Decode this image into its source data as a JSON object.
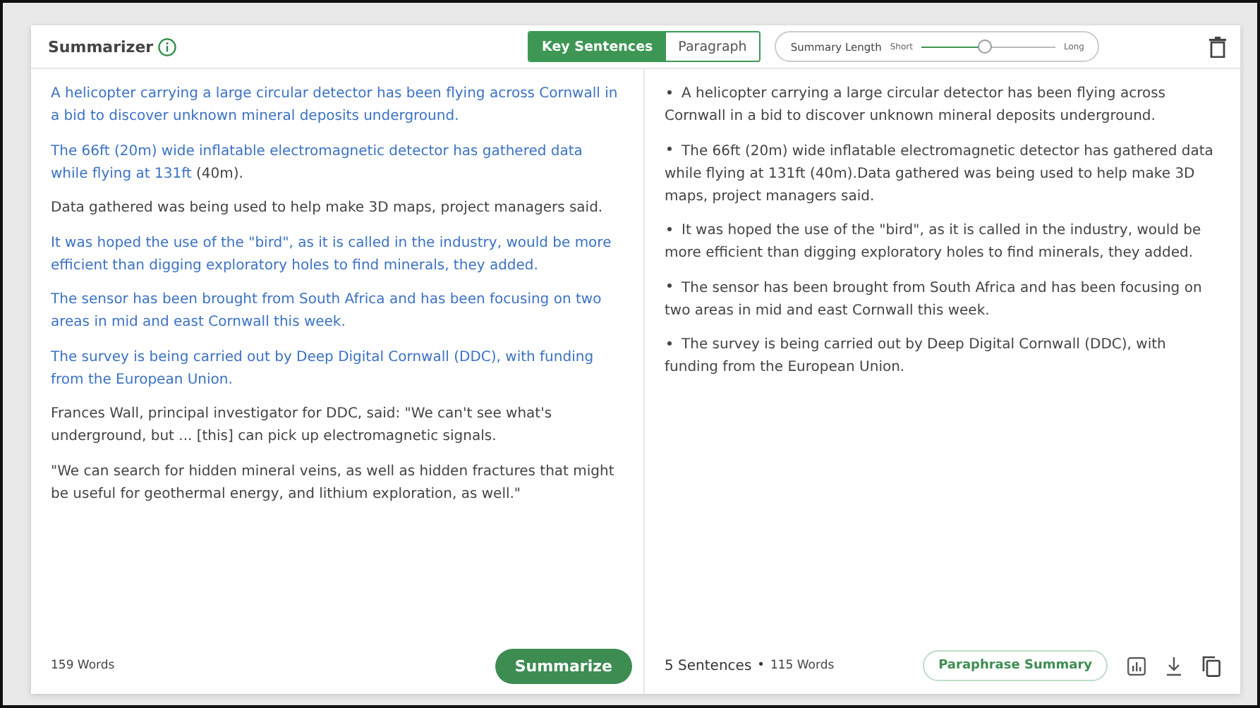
{
  "header": {
    "title": "Summarizer",
    "modes": [
      {
        "label": "Key Sentences",
        "selected": true
      },
      {
        "label": "Paragraph",
        "selected": false
      }
    ],
    "length": {
      "label": "Summary Length",
      "min_label": "Short",
      "max_label": "Long",
      "level": 0.47
    }
  },
  "input": {
    "paragraphs": [
      [
        {
          "text": "A helicopter carrying a large circular detector has been flying across Cornwall in a bid to discover unknown mineral deposits underground.",
          "highlighted": true
        }
      ],
      [
        {
          "text": "The 66ft (20m) wide inflatable electromagnetic detector has gathered data while flying at 131ft",
          "highlighted": true
        },
        {
          "text": " (40m).",
          "highlighted": false
        }
      ],
      [
        {
          "text": "Data gathered was being used to help make 3D maps, project managers said.",
          "highlighted": false
        }
      ],
      [
        {
          "text": "It was hoped the use of the \"bird\", as it is called in the industry, would be more efficient than digging exploratory holes to find minerals, they added.",
          "highlighted": true
        }
      ],
      [
        {
          "text": "The sensor has been brought from South Africa and has been focusing on two areas in mid and east Cornwall this week.",
          "highlighted": true
        }
      ],
      [
        {
          "text": "The survey is being carried out by Deep Digital Cornwall (DDC), with funding from the European Union.",
          "highlighted": true
        }
      ],
      [
        {
          "text": "Frances Wall, principal investigator for DDC, said: \"We can't see what's underground, but ... [this] can pick up electromagnetic signals.",
          "highlighted": false
        }
      ],
      [
        {
          "text": "\"We can search for hidden mineral veins, as well as hidden fractures that might be useful for geothermal energy, and lithium exploration, as well.\"",
          "highlighted": false
        }
      ]
    ],
    "word_count": "159 Words",
    "action": "Summarize"
  },
  "output": {
    "bullets": [
      "A helicopter carrying a large circular detector has been flying across Cornwall in a bid to discover unknown mineral deposits underground.",
      "The 66ft (20m) wide inflatable electromagnetic detector has gathered data while flying at 131ft (40m).Data gathered was being used to help make 3D maps, project managers said.",
      "It was hoped the use of the \"bird\", as it is called in the industry, would be more efficient than digging exploratory holes to find minerals, they added.",
      "The sensor has been brought from South Africa and has been focusing on two areas in mid and east Cornwall this week.",
      "The survey is being carried out by Deep Digital Cornwall (DDC), with funding from the European Union."
    ],
    "sentence_count": "5 Sentences",
    "separator": "•",
    "word_count": "115 Words",
    "action": "Paraphrase Summary"
  }
}
